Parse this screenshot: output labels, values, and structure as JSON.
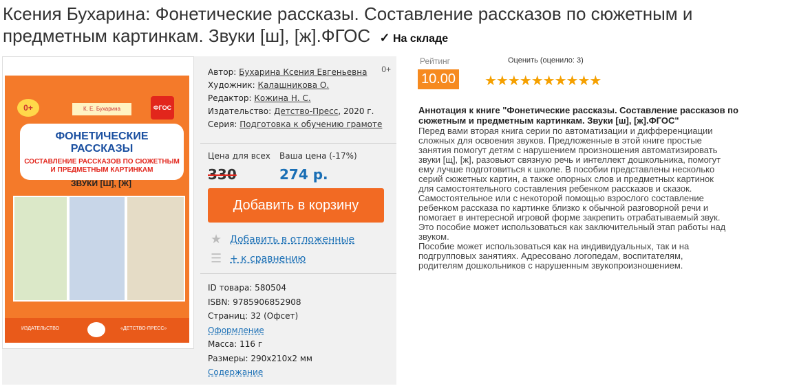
{
  "product": {
    "title": "Ксения Бухарина: Фонетические рассказы. Составление рассказов по сюжетным и предметным картинкам. Звуки [ш], [ж].ФГОС",
    "stock_check": "✓",
    "stock_label": "На складе"
  },
  "cover": {
    "age_badge": "0+",
    "author_tag": "К. Е. Бухарина",
    "fgos_badge": "ФГОС",
    "title_main": "ФОНЕТИЧЕСКИЕ РАССКАЗЫ",
    "title_sub": "СОСТАВЛЕНИЕ РАССКАЗОВ ПО СЮЖЕТНЫМ И ПРЕДМЕТНЫМ КАРТИНКАМ",
    "sounds": "ЗВУКИ [Ш], [Ж]",
    "bottom_left": "ИЗДАТЕЛЬСТВО",
    "bottom_right": "«ДЕТСТВО-ПРЕСС»"
  },
  "meta": {
    "author_label": "Автор:",
    "author": "Бухарина Ксения Евгеньевна",
    "illustrator_label": "Художник:",
    "illustrator": "Калашникова О.",
    "editor_label": "Редактор:",
    "editor": "Кожина Н. С.",
    "publisher_label": "Издательство:",
    "publisher": "Детство-Пресс",
    "year": ", 2020 г.",
    "series_label": "Серия:",
    "series": "Подготовка к обучению грамоте",
    "age": "0+"
  },
  "price": {
    "label_all": "Цена для всех",
    "label_yours": "Ваша цена (-17%)",
    "old": "330",
    "new": "274 р."
  },
  "actions": {
    "cart": "Добавить в корзину",
    "wishlist": "Добавить в отложенные",
    "compare": "+ к сравнению"
  },
  "details": {
    "id": "ID товара: 580504",
    "isbn": "ISBN: 9785906852908",
    "pages": "Страниц: 32 (Офсет)",
    "design_link": "Оформление",
    "weight": "Масса: 116 г",
    "size": "Размеры: 290x210x2 мм",
    "contents_link": "Содержание"
  },
  "rating": {
    "label": "Рейтинг",
    "rate_label": "Оценить (оценило: 3)",
    "score": "10.00",
    "stars": "★★★★★★★★★★"
  },
  "annotation": {
    "title": "Аннотация к книге \"Фонетические рассказы. Составление рассказов по сюжетным и предметным картинкам. Звуки [ш], [ж].ФГОС\"",
    "text": "Перед вами вторая книга серии по автоматизации и дифференциации\nсложных для освоения звуков. Предложенные в этой книге простые\nзанятия помогут детям с нарушением произношения автоматизировать\nзвуки [щ], [ж], разовьют связную речь и интеллект дошкольника, помогут\nему лучше подготовиться к школе. В пособии представлены несколько\nсерий сюжетных картин, а также опорных слов и предметных картинок\nдля самостоятельного составления ребенком рассказов и сказок.\nСамостоятельное или с некоторой помощью взрослого составление\nребенком рассказа по картинке близко к обычной разговорной речи и\nпомогает в интересной игровой форме закрепить отрабатываемый звук.\nЭто пособие может использоваться как заключительный этап работы над\nзвуком.\nПособие может использоваться как на индивидуальных, так и на\nподгрупповых занятиях. Адресовано логопедам, воспитателям,\nродителям дошкольников с нарушенным звукопроизношением."
  }
}
